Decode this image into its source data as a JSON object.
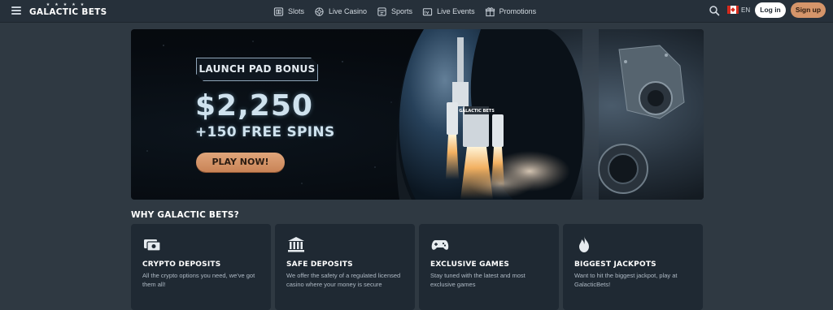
{
  "header": {
    "logo_text": "GALACTIC BETS",
    "logo_stars": "★★★★★",
    "nav": [
      {
        "label": "Slots",
        "icon": "slots-icon"
      },
      {
        "label": "Live Casino",
        "icon": "live-casino-icon"
      },
      {
        "label": "Sports",
        "icon": "sports-icon"
      },
      {
        "label": "Live Events",
        "icon": "live-events-icon"
      },
      {
        "label": "Promotions",
        "icon": "promotions-icon"
      }
    ],
    "language": "EN",
    "login_label": "Log in",
    "signup_label": "Sign up"
  },
  "hero": {
    "badge": "LAUNCH PAD BONUS",
    "amount": "$2,250",
    "spins": "+150 FREE SPINS",
    "cta": "PLAY NOW!",
    "rocket_text": "GALACTIC BETS"
  },
  "why": {
    "title": "WHY GALACTIC BETS?",
    "cards": [
      {
        "icon": "crypto-icon",
        "title": "CRYPTO DEPOSITS",
        "text": "All the crypto options you need, we've got them all!"
      },
      {
        "icon": "bank-icon",
        "title": "SAFE DEPOSITS",
        "text": "We offer the safety of a regulated licensed casino where your money is secure"
      },
      {
        "icon": "gamepad-icon",
        "title": "EXCLUSIVE GAMES",
        "text": "Stay tuned with the latest and most exclusive games"
      },
      {
        "icon": "flame-icon",
        "title": "BIGGEST JACKPOTS",
        "text": "Want to hit the biggest jackpot, play at GalacticBets!"
      }
    ]
  },
  "colors": {
    "background": "#2f3942",
    "topbar": "#26303a",
    "card": "#1f2933",
    "accent": "#d5956a"
  }
}
